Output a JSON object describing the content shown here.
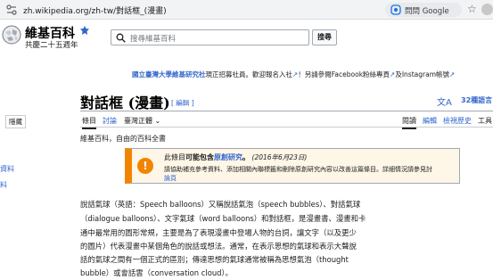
{
  "browser": {
    "url": "zh.wikipedia.org/zh-tw/對話框_(漫畫)",
    "translate_label": "問問 Google"
  },
  "header": {
    "logo_title": "維基百科",
    "logo_subtitle": "共慶二十五週年",
    "search_placeholder": "搜尋維基百科",
    "search_button": "搜尋"
  },
  "banner": {
    "org": "國立臺灣大學維基研究社",
    "text": "現正招募社員。歡迎報名入社",
    "text2": "！另請參閱Facebook粉絲專頁",
    "text3": "及Instagram帳號"
  },
  "page": {
    "title": "對話框 (漫畫)",
    "edit_link": "[ 編輯 ]",
    "languages": "32種語言",
    "tagline": "維基百科，自由的百科全書"
  },
  "tabs": {
    "article": "條目",
    "talk": "討論",
    "variant": "臺灣正體",
    "read": "閱讀",
    "edit": "編輯",
    "history": "檢視歷史",
    "tools": "工具"
  },
  "sidebar": {
    "hide_label": "隱藏",
    "link1": "資料",
    "link2": "料"
  },
  "ambox": {
    "line1_a": "此條目",
    "line1_b": "可能包含",
    "line1_c": "原創研究",
    "line1_d": "。",
    "line1_date": "(2016年6月23日)",
    "line2": "請協助補充參考資料、添加相關內聯標籤和刪除原創研究內容以改善這篇條目。詳細情況請參見討",
    "line3": "論頁"
  },
  "paragraph": {
    "l1": "說話氣球（英語：Speech balloons）又稱說話氣泡（speech bubbles）、對話氣球",
    "l2": "（dialogue balloons）、文字氣球（word balloons）和對話框，是漫畫書、漫畫和卡",
    "l3": "通中最常用的圖形常規，主要是為了表現漫畫中登場人物的台詞，讓文字（以及更少",
    "l4": "的圖片）代表漫畫中某個角色的說話或想法。通常，在表示思想的氣球和表示大聲說",
    "l5": "話的氣球之間有一個正式的區別；傳達思想的氣球通常被稱為思想氣泡（thought",
    "l6": "bubble）或會話雲（conversation cloud）。"
  },
  "colors": {
    "link": "#3366cc",
    "notice_accent": "#f28500",
    "notice_bg": "#fef6e7"
  }
}
